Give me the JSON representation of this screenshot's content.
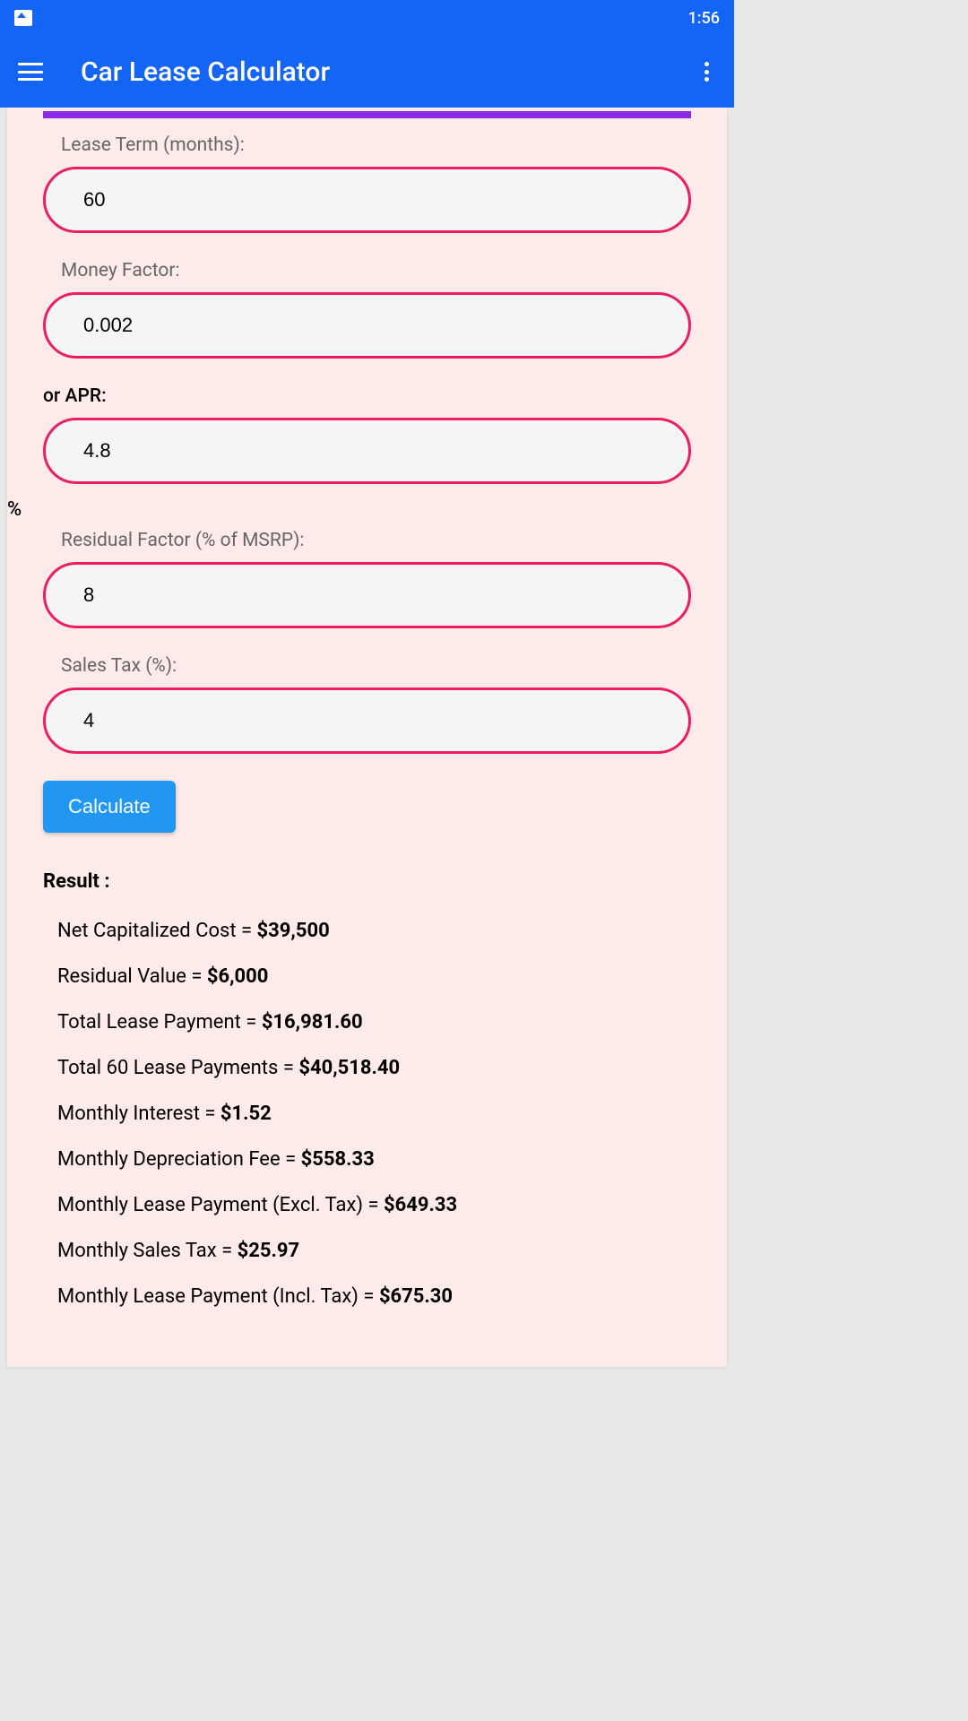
{
  "status_bar": {
    "time": "1:56"
  },
  "app_bar": {
    "title": "Car Lease Calculator"
  },
  "fields": {
    "lease_term": {
      "label": "Lease Term (months):",
      "value": "60"
    },
    "money_factor": {
      "label": "Money Factor:",
      "value": "0.002"
    },
    "apr": {
      "label": "or APR:",
      "value": "4.8"
    },
    "percent_symbol": "%",
    "residual_factor": {
      "label": "Residual Factor (% of MSRP):",
      "value": "8"
    },
    "sales_tax": {
      "label": "Sales Tax (%):",
      "value": "4"
    }
  },
  "buttons": {
    "calculate": "Calculate"
  },
  "result": {
    "heading": "Result :",
    "lines": [
      {
        "label": "Net Capitalized Cost = ",
        "value": "$39,500"
      },
      {
        "label": "Residual Value = ",
        "value": "$6,000"
      },
      {
        "label": "Total Lease Payment = ",
        "value": "$16,981.60"
      },
      {
        "label": "Total 60 Lease Payments = ",
        "value": "$40,518.40"
      },
      {
        "label": "Monthly Interest = ",
        "value": "$1.52"
      },
      {
        "label": "Monthly Depreciation Fee = ",
        "value": "$558.33"
      },
      {
        "label": "Monthly Lease Payment (Excl. Tax) = ",
        "value": "$649.33"
      },
      {
        "label": "Monthly Sales Tax = ",
        "value": "$25.97"
      },
      {
        "label": "Monthly Lease Payment (Incl. Tax) = ",
        "value": "$675.30"
      }
    ]
  }
}
